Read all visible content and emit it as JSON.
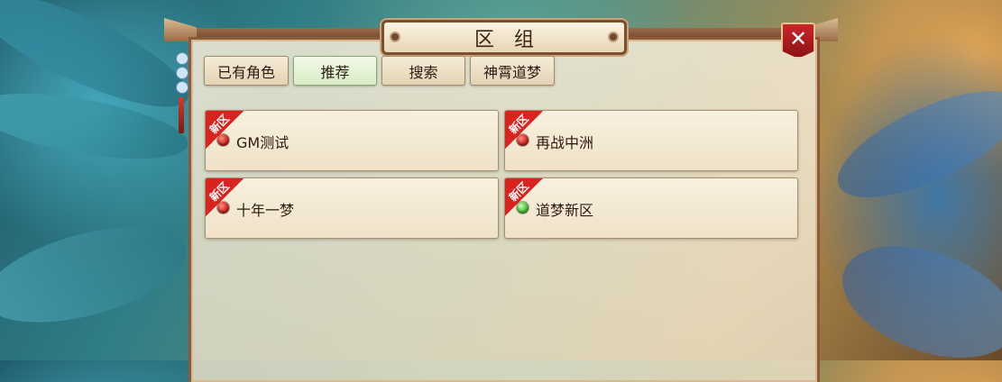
{
  "window": {
    "title": "区组",
    "close_label": "✕"
  },
  "tabs": [
    {
      "label": "已有角色",
      "active": false
    },
    {
      "label": "推荐",
      "active": true
    },
    {
      "label": "搜索",
      "active": false
    },
    {
      "label": "神霄道梦",
      "active": false
    }
  ],
  "servers": [
    {
      "name": "GM测试",
      "badge": "新区",
      "status": "red"
    },
    {
      "name": "再战中洲",
      "badge": "新区",
      "status": "red"
    },
    {
      "name": "十年一梦",
      "badge": "新区",
      "status": "red"
    },
    {
      "name": "道梦新区",
      "badge": "新区",
      "status": "green"
    }
  ],
  "colors": {
    "status_red": "#c8241d",
    "status_green": "#3fbf35",
    "badge_red": "#d8231f",
    "frame": "#8a5a3b"
  }
}
